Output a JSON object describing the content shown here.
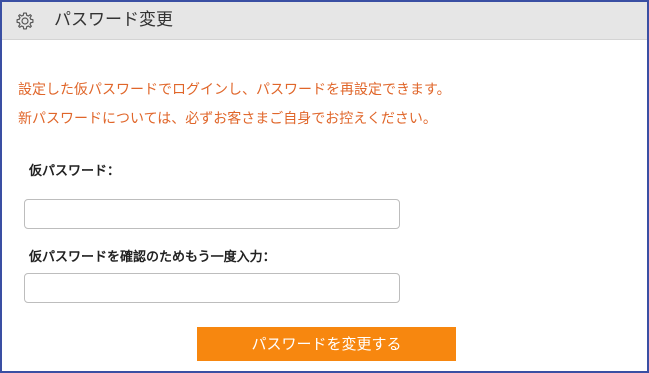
{
  "header": {
    "icon": "gear-icon",
    "title": "パスワード変更"
  },
  "notice": {
    "line1": "設定した仮パスワードでログインし、パスワードを再設定できます。",
    "line2": "新パスワードについては、必ずお客さまご自身でお控えください。",
    "color": "#e0662a"
  },
  "form": {
    "temp_password_label": "仮パスワード：",
    "temp_password_value": "",
    "confirm_label": "仮パスワードを確認のためもう一度入力：",
    "confirm_value": "",
    "submit_label": "パスワードを変更する",
    "submit_color": "#f7870f"
  }
}
